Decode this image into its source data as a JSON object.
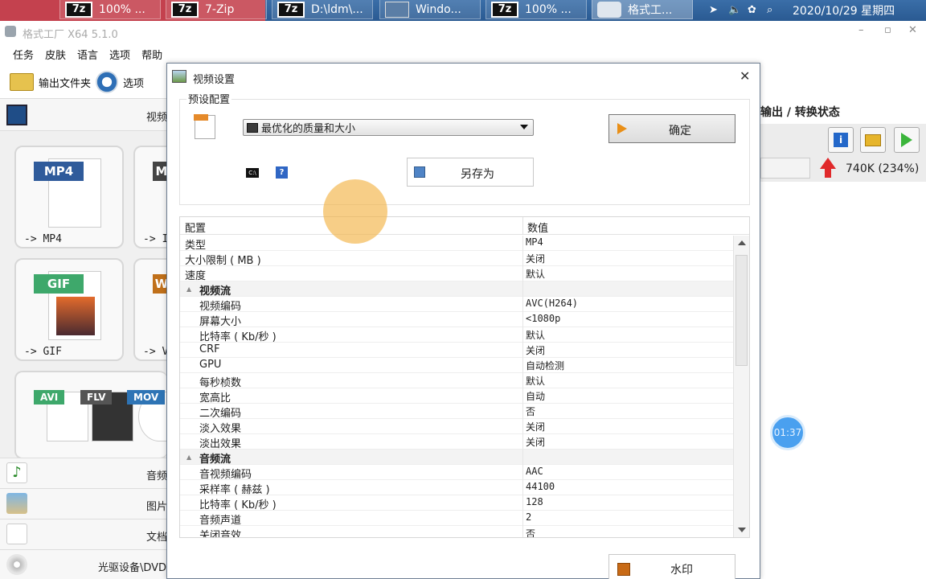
{
  "taskbar": {
    "buttons": [
      {
        "label": "100% ...",
        "icon": "7z-icon"
      },
      {
        "label": "7-Zip",
        "icon": "7z-icon"
      },
      {
        "label": "D:\\ldm\\...",
        "icon": "7z-icon"
      },
      {
        "label": "Windo...",
        "icon": "window-icon"
      },
      {
        "label": "100% ...",
        "icon": "7z-icon"
      },
      {
        "label": "格式工...",
        "icon": "format-factory-icon"
      }
    ],
    "clock": "2020/10/29 星期四"
  },
  "window": {
    "title": "格式工厂 X64 5.1.0",
    "controls": {
      "minimize": "–",
      "maximize": "▫",
      "close": "✕"
    }
  },
  "menu": [
    "任务",
    "皮肤",
    "语言",
    "选项",
    "帮助"
  ],
  "toolbar": {
    "output_folder": "输出文件夹",
    "options": "选项"
  },
  "left_panel": {
    "video_header": "视频",
    "tiles": [
      {
        "badge": "MP4",
        "label": "-> MP4",
        "badge_color": "#2f5b9b"
      },
      {
        "badge": "M",
        "label": "-> I",
        "badge_color": "#444444"
      },
      {
        "badge": "GIF",
        "label": "-> GIF",
        "badge_color": "#3ea86b"
      },
      {
        "badge": "W",
        "label": "-> V",
        "badge_color": "#c0701a"
      }
    ],
    "multi_badges": [
      {
        "label": "AVI",
        "color": "#3ea86b"
      },
      {
        "label": "FLV",
        "color": "#555555"
      },
      {
        "label": "MOV",
        "color": "#2e74b5"
      }
    ],
    "categories": [
      "音频",
      "图片",
      "文档",
      "光驱设备\\DVD"
    ]
  },
  "right_panel": {
    "header": "输出 / 转换状态",
    "size_text": "740K  (234%)",
    "timer": "01:37"
  },
  "dialog": {
    "title": "视频设置",
    "close": "✕",
    "preset_group_label": "预设配置",
    "preset_value": "最优化的质量和大小",
    "ok_button": "确定",
    "save_as_button": "另存为",
    "watermark_button": "水印",
    "cl_icon_text": "C:\\",
    "help_icon_text": "?",
    "grid": {
      "col_key": "配置",
      "col_value": "数值",
      "rows": [
        {
          "key": "类型",
          "value": "MP4",
          "kind": "row"
        },
        {
          "key": "大小限制 ( MB )",
          "value": "关闭",
          "kind": "row"
        },
        {
          "key": "速度",
          "value": "默认",
          "kind": "row"
        },
        {
          "key": "视频流",
          "value": "",
          "kind": "section"
        },
        {
          "key": "视频编码",
          "value": "AVC(H264)",
          "kind": "sub"
        },
        {
          "key": "屏幕大小",
          "value": "<1080p",
          "kind": "sub"
        },
        {
          "key": "比特率 ( Kb/秒 )",
          "value": "默认",
          "kind": "sub"
        },
        {
          "key": "CRF",
          "value": "关闭",
          "kind": "sub"
        },
        {
          "key": "GPU",
          "value": "自动检测",
          "kind": "sub"
        },
        {
          "key": "每秒桢数",
          "value": "默认",
          "kind": "sub"
        },
        {
          "key": "宽高比",
          "value": "自动",
          "kind": "sub"
        },
        {
          "key": "二次编码",
          "value": "否",
          "kind": "sub"
        },
        {
          "key": "淡入效果",
          "value": "关闭",
          "kind": "sub"
        },
        {
          "key": "淡出效果",
          "value": "关闭",
          "kind": "sub"
        },
        {
          "key": "音频流",
          "value": "",
          "kind": "section"
        },
        {
          "key": "音视频编码",
          "value": "AAC",
          "kind": "sub"
        },
        {
          "key": "采样率 ( 赫兹 )",
          "value": "44100",
          "kind": "sub"
        },
        {
          "key": "比特率 ( Kb/秒 )",
          "value": "128",
          "kind": "sub"
        },
        {
          "key": "音频声道",
          "value": "2",
          "kind": "sub"
        },
        {
          "key": "关闭音效",
          "value": "否",
          "kind": "sub"
        }
      ]
    }
  }
}
